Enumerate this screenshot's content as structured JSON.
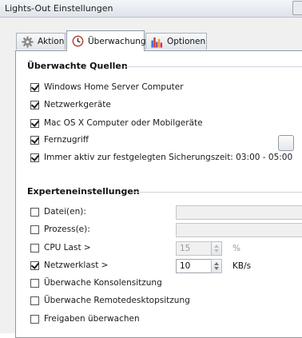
{
  "window": {
    "title": "Lights-Out Einstellungen"
  },
  "tabs": [
    {
      "label": "Aktion",
      "icon": "gear-icon",
      "active": false
    },
    {
      "label": "Überwachung",
      "icon": "clock-icon",
      "active": true
    },
    {
      "label": "Optionen",
      "icon": "bar-chart-icon",
      "active": false
    }
  ],
  "watched_sources": {
    "heading": "Überwachte Quellen",
    "items": [
      {
        "label": "Windows Home Server Computer",
        "checked": true
      },
      {
        "label": "Netzwerkgeräte",
        "checked": true
      },
      {
        "label": "Mac OS X Computer oder Mobilgeräte",
        "checked": true
      },
      {
        "label": "Fernzugriff",
        "checked": true
      },
      {
        "label": "Immer aktiv zur festgelegten Sicherungszeit: 03:00 - 05:00",
        "checked": true
      }
    ]
  },
  "expert": {
    "heading": "Experteneinstellungen",
    "files": {
      "label": "Datei(en):",
      "checked": false,
      "value": ""
    },
    "processes": {
      "label": "Prozess(e):",
      "checked": false,
      "value": ""
    },
    "cpu": {
      "label": "CPU Last >",
      "checked": false,
      "value": "15",
      "unit": "%"
    },
    "network": {
      "label": "Netzwerklast >",
      "checked": true,
      "value": "10",
      "unit": "KB/s"
    },
    "console": {
      "label": "Überwache Konsolensitzung",
      "checked": false
    },
    "remote": {
      "label": "Überwache Remotedesktopsitzung",
      "checked": false
    },
    "shares": {
      "label": "Freigaben überwachen",
      "checked": false
    }
  }
}
